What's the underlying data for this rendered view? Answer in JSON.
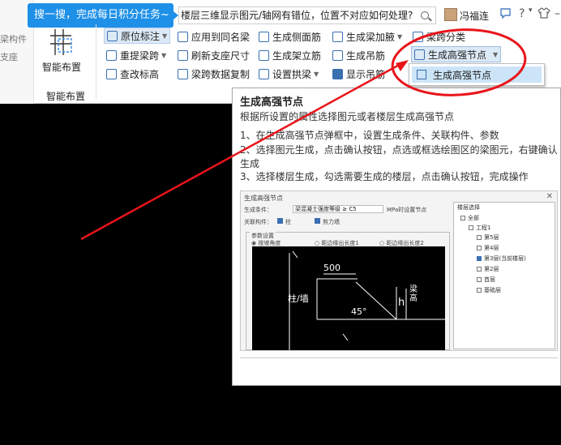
{
  "colors": {
    "accent": "#1e90e8",
    "annotation": "#e8141a",
    "canvas": "#000000",
    "selected": "#cce4f7"
  },
  "left_strip": {
    "line1": "梁构件",
    "line2": "支座"
  },
  "top_tip": {
    "text": "搜一搜，完成每日积分任务~"
  },
  "search": {
    "value": "楼层三维显示图元/轴网有错位，位置不对应如何处理?"
  },
  "user": {
    "name": "冯福连"
  },
  "top_icons": {
    "chat": "speech-bubble-icon",
    "help": "?",
    "shirt": "shirt-icon"
  },
  "smart_layout": {
    "label": "智能布置",
    "group_label": "智能布置"
  },
  "toolbar": {
    "yuanwei": "原位标注",
    "yingyong": "应用到同名梁",
    "cemianjin": "生成侧面筋",
    "jiayi": "生成梁加腋",
    "liangkua": "梁跨分类",
    "chongti": "重提梁跨",
    "shuaxin": "刷新支座尺寸",
    "jialijin": "生成架立筋",
    "diaojin": "生成吊筋",
    "gaoqiang": "生成高强节点",
    "chagai": "查改标高",
    "fuzhi": "梁跨数据复制",
    "gongjin": "设置拱梁",
    "xianshi": "显示吊筋"
  },
  "dropdown": {
    "item": "生成高强节点"
  },
  "tooltip": {
    "title": "生成高强节点",
    "desc": "根据所设置的属性选择图元或者楼层生成高强节点",
    "step1": "1、在生成高强节点弹框中，设置生成条件、关联构件、参数",
    "step2": "2、选择图元生成，点击确认按钮，点选或框选绘图区的梁图元，右键确认生成",
    "step3": "3、选择楼层生成，勾选需要生成的楼层，点击确认按钮，完成操作"
  },
  "preview": {
    "title": "生成高强节点",
    "cond_label": "生成条件：",
    "cond_value": "梁混凝土强度等级 ≥ C5",
    "mpa": "MPa时设置节点",
    "related_label": "关联构件：",
    "col": "柱",
    "wall": "剪力墙",
    "params_label": "参数设置",
    "opt1": "按坡角度",
    "opt2": "距边缘出长度1",
    "opt3": "距边缘出长度2",
    "cad_col": "柱/墙",
    "cad_500": "500",
    "cad_45": "45°",
    "cad_h": "h",
    "cad_beam": "梁高",
    "tree_header": "楼层选择",
    "tree": [
      "全部",
      "工程1",
      "第5层",
      "第4层",
      "第3层(当前楼层)",
      "第2层",
      "首层",
      "基础层"
    ]
  }
}
